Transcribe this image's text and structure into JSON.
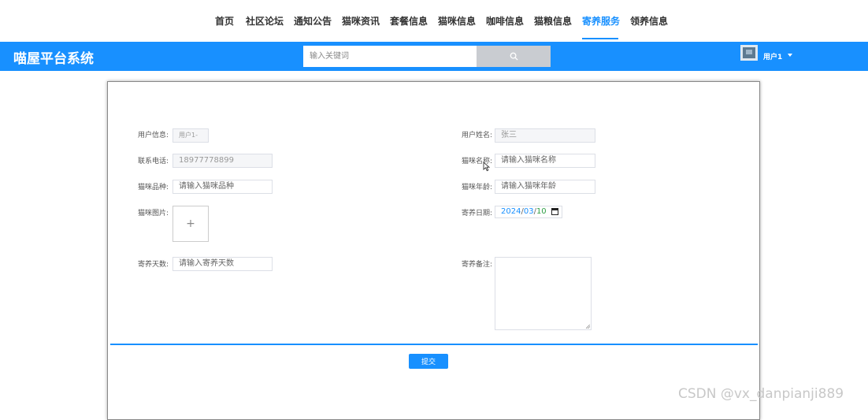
{
  "nav": {
    "items": [
      "首页",
      "社区论坛",
      "通知公告",
      "猫咪资讯",
      "套餐信息",
      "猫咪信息",
      "咖啡信息",
      "猫粮信息",
      "寄养服务",
      "领养信息"
    ],
    "active_index": 8
  },
  "header": {
    "brand": "喵屋平台系统",
    "search_placeholder": "输入关键词",
    "user_name": "用户1",
    "search_icon": "search-icon",
    "user_dropdown_icon": "chevron-down-icon"
  },
  "form": {
    "user_info": {
      "label": "用户信息:",
      "value": "用户1-"
    },
    "user_name": {
      "label": "用户姓名:",
      "value": "张三"
    },
    "phone": {
      "label": "联系电话:",
      "value": "18977778899"
    },
    "cat_name": {
      "label": "猫咪名称:",
      "placeholder": "请输入猫咪名称"
    },
    "cat_breed": {
      "label": "猫咪品种:",
      "placeholder": "请输入猫咪品种"
    },
    "cat_age": {
      "label": "猫咪年龄:",
      "placeholder": "请输入猫咪年龄"
    },
    "cat_image": {
      "label": "猫咪图片:",
      "upload_symbol": "+"
    },
    "board_date": {
      "label": "寄养日期:",
      "year": "2024",
      "month": "03",
      "day": "10",
      "sep": "/"
    },
    "board_days": {
      "label": "寄养天数:",
      "placeholder": "请输入寄养天数"
    },
    "board_note": {
      "label": "寄养备注:"
    },
    "submit_label": "提交"
  },
  "watermark": "CSDN @vx_danpianji889",
  "colors": {
    "accent": "#1890ff",
    "date_day": "#2e9e44"
  }
}
